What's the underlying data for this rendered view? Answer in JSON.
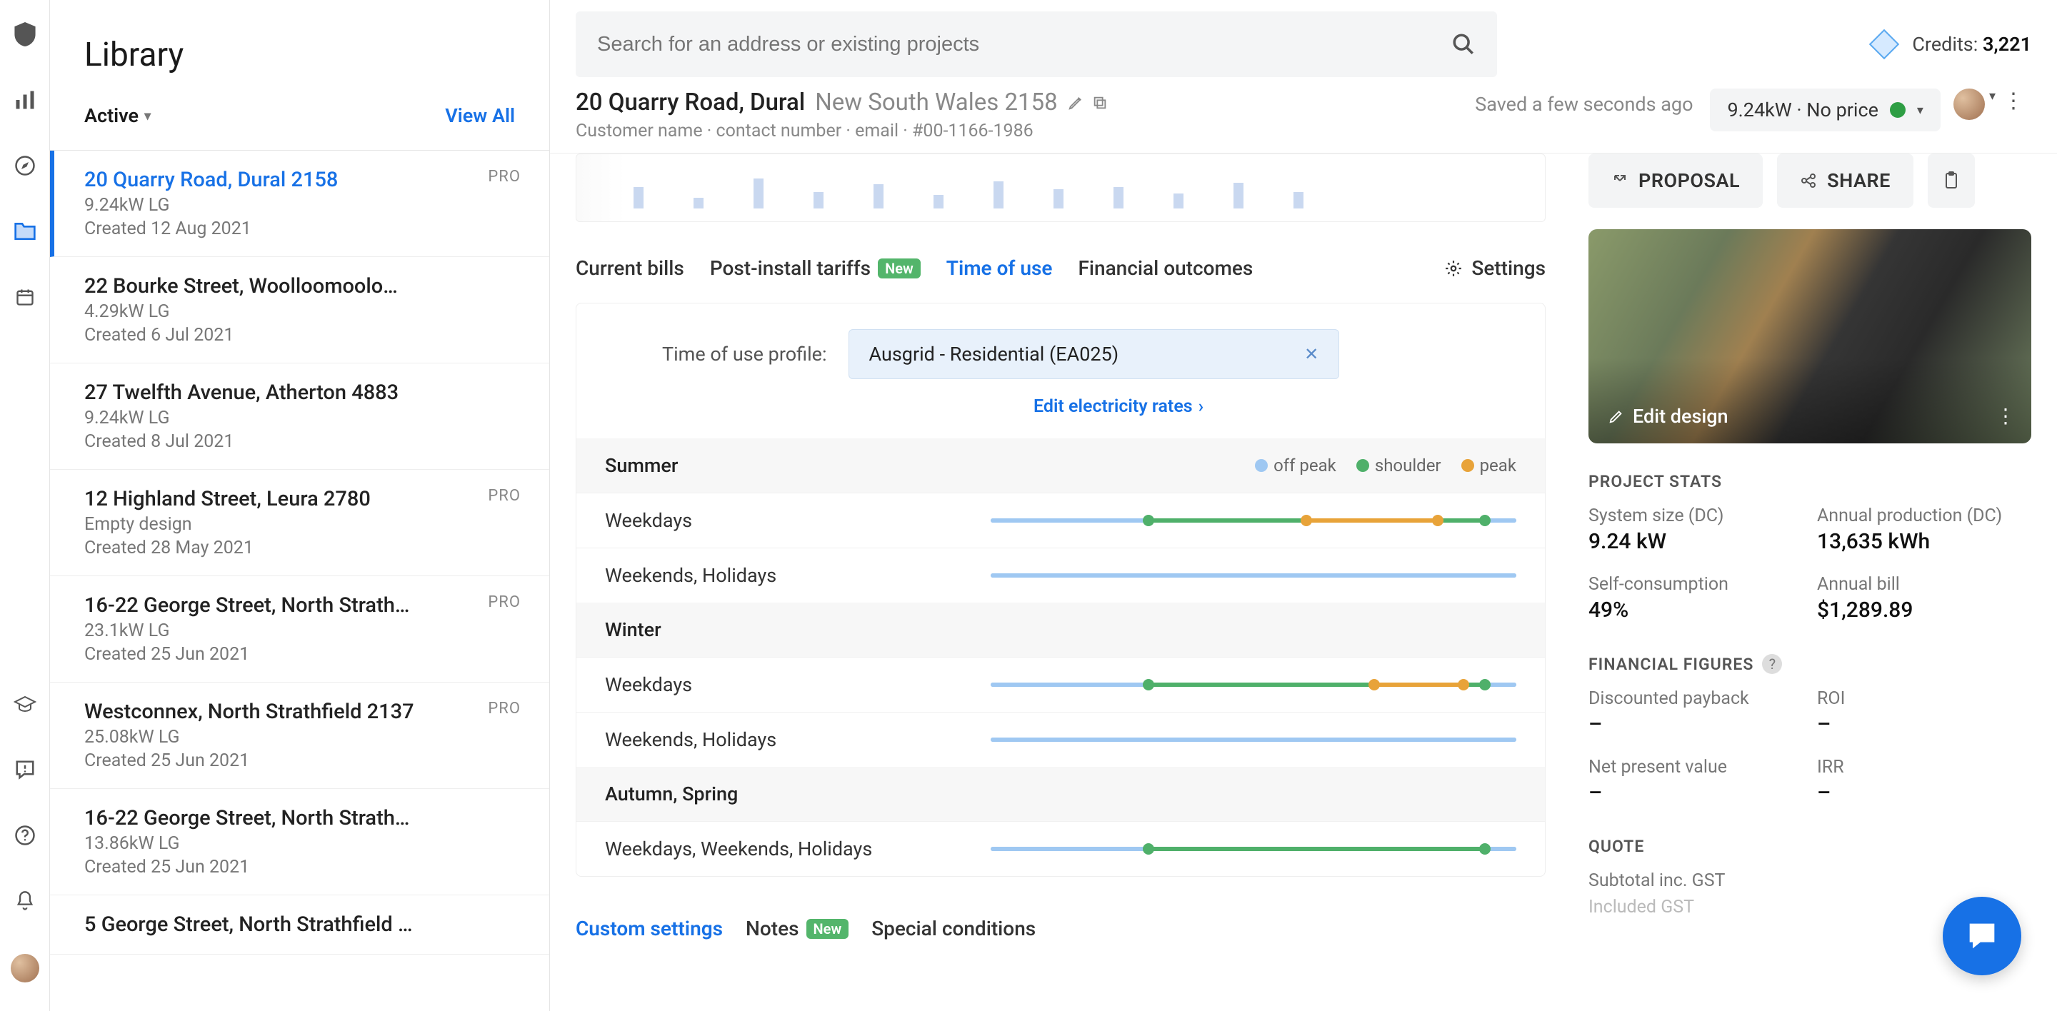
{
  "library": {
    "title": "Library",
    "filter_active": "Active",
    "view_all": "View All",
    "projects": [
      {
        "addr": "20 Quarry Road, Dural 2158",
        "meta": "9.24kW LG",
        "created": "Created 12 Aug 2021",
        "pro": "PRO",
        "selected": true
      },
      {
        "addr": "22 Bourke Street, Woolloomoolo…",
        "meta": "4.29kW LG",
        "created": "Created 6 Jul 2021",
        "pro": "",
        "selected": false
      },
      {
        "addr": "27 Twelfth Avenue, Atherton 4883",
        "meta": "9.24kW LG",
        "created": "Created 8 Jul 2021",
        "pro": "",
        "selected": false
      },
      {
        "addr": "12 Highland Street, Leura 2780",
        "meta": "Empty design",
        "created": "Created 28 May 2021",
        "pro": "PRO",
        "selected": false
      },
      {
        "addr": "16-22 George Street, North Strath…",
        "meta": "23.1kW LG",
        "created": "Created 25 Jun 2021",
        "pro": "PRO",
        "selected": false
      },
      {
        "addr": "Westconnex, North Strathfield 2137",
        "meta": "25.08kW LG",
        "created": "Created 25 Jun 2021",
        "pro": "PRO",
        "selected": false
      },
      {
        "addr": "16-22 George Street, North Strath…",
        "meta": "13.86kW LG",
        "created": "Created 25 Jun 2021",
        "pro": "",
        "selected": false
      },
      {
        "addr": "5 George Street, North Strathfield …",
        "meta": "",
        "created": "",
        "pro": "",
        "selected": false
      }
    ]
  },
  "search": {
    "placeholder": "Search for an address or existing projects"
  },
  "credits": {
    "label": "Credits: ",
    "value": "3,221"
  },
  "project": {
    "address": "20 Quarry Road, Dural",
    "region": "New South Wales 2158",
    "subline": "Customer name · contact number · email · #00-1166-1986",
    "saved": "Saved a few seconds ago",
    "system_pill": "9.24kW · No price"
  },
  "colors": {
    "primary": "#1771e6",
    "offpeak": "#9fc8f2",
    "shoulder": "#4fb06a",
    "peak": "#e8a339"
  },
  "tabs": {
    "current_bills": "Current bills",
    "post_install": "Post-install tariffs",
    "post_install_new": "New",
    "time_of_use": "Time of use",
    "financial": "Financial outcomes",
    "settings": "Settings"
  },
  "tou": {
    "profile_label": "Time of use profile:",
    "profile_value": "Ausgrid - Residential (EA025)",
    "edit_rates": "Edit electricity rates",
    "legend": {
      "off": "off peak",
      "shoulder": "shoulder",
      "peak": "peak"
    },
    "seasons": [
      {
        "name": "Summer",
        "rows": [
          {
            "label": "Weekdays",
            "pattern": "A"
          },
          {
            "label": "Weekends, Holidays",
            "pattern": "B"
          }
        ]
      },
      {
        "name": "Winter",
        "rows": [
          {
            "label": "Weekdays",
            "pattern": "C"
          },
          {
            "label": "Weekends, Holidays",
            "pattern": "B"
          }
        ]
      },
      {
        "name": "Autumn, Spring",
        "rows": [
          {
            "label": "Weekdays, Weekends, Holidays",
            "pattern": "D"
          }
        ]
      }
    ]
  },
  "bottom_tabs": {
    "custom": "Custom settings",
    "notes": "Notes",
    "notes_new": "New",
    "special": "Special conditions"
  },
  "actions": {
    "proposal": "PROPOSAL",
    "share": "SHARE"
  },
  "design": {
    "edit": "Edit design"
  },
  "stats": {
    "title": "PROJECT STATS",
    "items": [
      {
        "label": "System size (DC)",
        "value": "9.24 kW"
      },
      {
        "label": "Annual production (DC)",
        "value": "13,635 kWh"
      },
      {
        "label": "Self-consumption",
        "value": "49%"
      },
      {
        "label": "Annual bill",
        "value": "$1,289.89"
      }
    ]
  },
  "financial": {
    "title": "FINANCIAL FIGURES",
    "items": [
      {
        "label": "Discounted payback",
        "value": "–"
      },
      {
        "label": "ROI",
        "value": "–"
      },
      {
        "label": "Net present value",
        "value": "–"
      },
      {
        "label": "IRR",
        "value": "–"
      }
    ]
  },
  "quote": {
    "title": "QUOTE",
    "subtotal": "Subtotal inc. GST",
    "included": "Included GST"
  }
}
